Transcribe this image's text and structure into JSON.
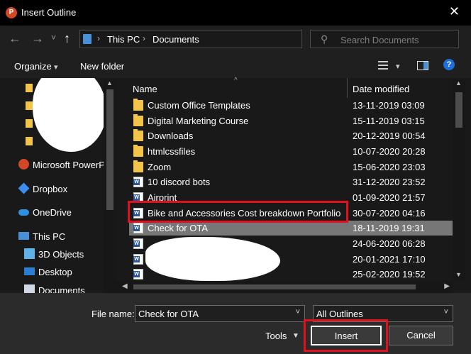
{
  "window": {
    "title": "Insert Outline",
    "app_icon": "P"
  },
  "nav": {
    "back": "←",
    "forward": "→",
    "recent": "˅",
    "up": "↑",
    "breadcrumbs": [
      "This PC",
      "Documents"
    ],
    "refresh": "↻",
    "search_placeholder": "Search Documents"
  },
  "toolbar": {
    "organize": "Organize",
    "new_folder": "New folder",
    "help": "?"
  },
  "sidebar": {
    "items": [
      {
        "label": "Microsoft PowerPo",
        "icon": "powerpoint-icon"
      },
      {
        "label": "Dropbox",
        "icon": "dropbox-icon"
      },
      {
        "label": "OneDrive",
        "icon": "onedrive-icon"
      },
      {
        "label": "This PC",
        "icon": "this-pc-icon"
      },
      {
        "label": "3D Objects",
        "icon": "3d-objects-icon"
      },
      {
        "label": "Desktop",
        "icon": "desktop-icon"
      },
      {
        "label": "Documents",
        "icon": "documents-icon"
      }
    ]
  },
  "columns": {
    "name": "Name",
    "date_modified": "Date modified"
  },
  "files": [
    {
      "name": "Custom Office Templates",
      "date": "13-11-2019 03:09",
      "type": "folder"
    },
    {
      "name": "Digital Marketing Course",
      "date": "15-11-2019 03:15",
      "type": "folder"
    },
    {
      "name": "Downloads",
      "date": "20-12-2019 00:54",
      "type": "folder"
    },
    {
      "name": "htmlcssfiles",
      "date": "10-07-2020 20:28",
      "type": "folder"
    },
    {
      "name": "Zoom",
      "date": "15-06-2020 23:03",
      "type": "folder"
    },
    {
      "name": "10 discord bots",
      "date": "31-12-2020 23:52",
      "type": "word"
    },
    {
      "name": "Airprint",
      "date": "01-09-2020 21:57",
      "type": "word"
    },
    {
      "name": "Bike and Accessories Cost breakdown Portfolio",
      "date": "30-07-2020 04:16",
      "type": "word"
    },
    {
      "name": "Check for OTA",
      "date": "18-11-2019 19:31",
      "type": "word",
      "selected": true
    },
    {
      "name": "",
      "date": "24-06-2020 06:28",
      "type": "word"
    },
    {
      "name": "",
      "date": "20-01-2021 17:10",
      "type": "word"
    },
    {
      "name": "",
      "date": "25-02-2020 19:52",
      "type": "word"
    }
  ],
  "footer": {
    "file_name_label": "File name:",
    "file_name_value": "Check for OTA",
    "filter_value": "All Outlines",
    "tools": "Tools",
    "insert": "Insert",
    "cancel": "Cancel"
  },
  "colors": {
    "highlight": "#e0101c",
    "selection": "#777777",
    "folder": "#f2c54a",
    "word": "#2b579a"
  }
}
